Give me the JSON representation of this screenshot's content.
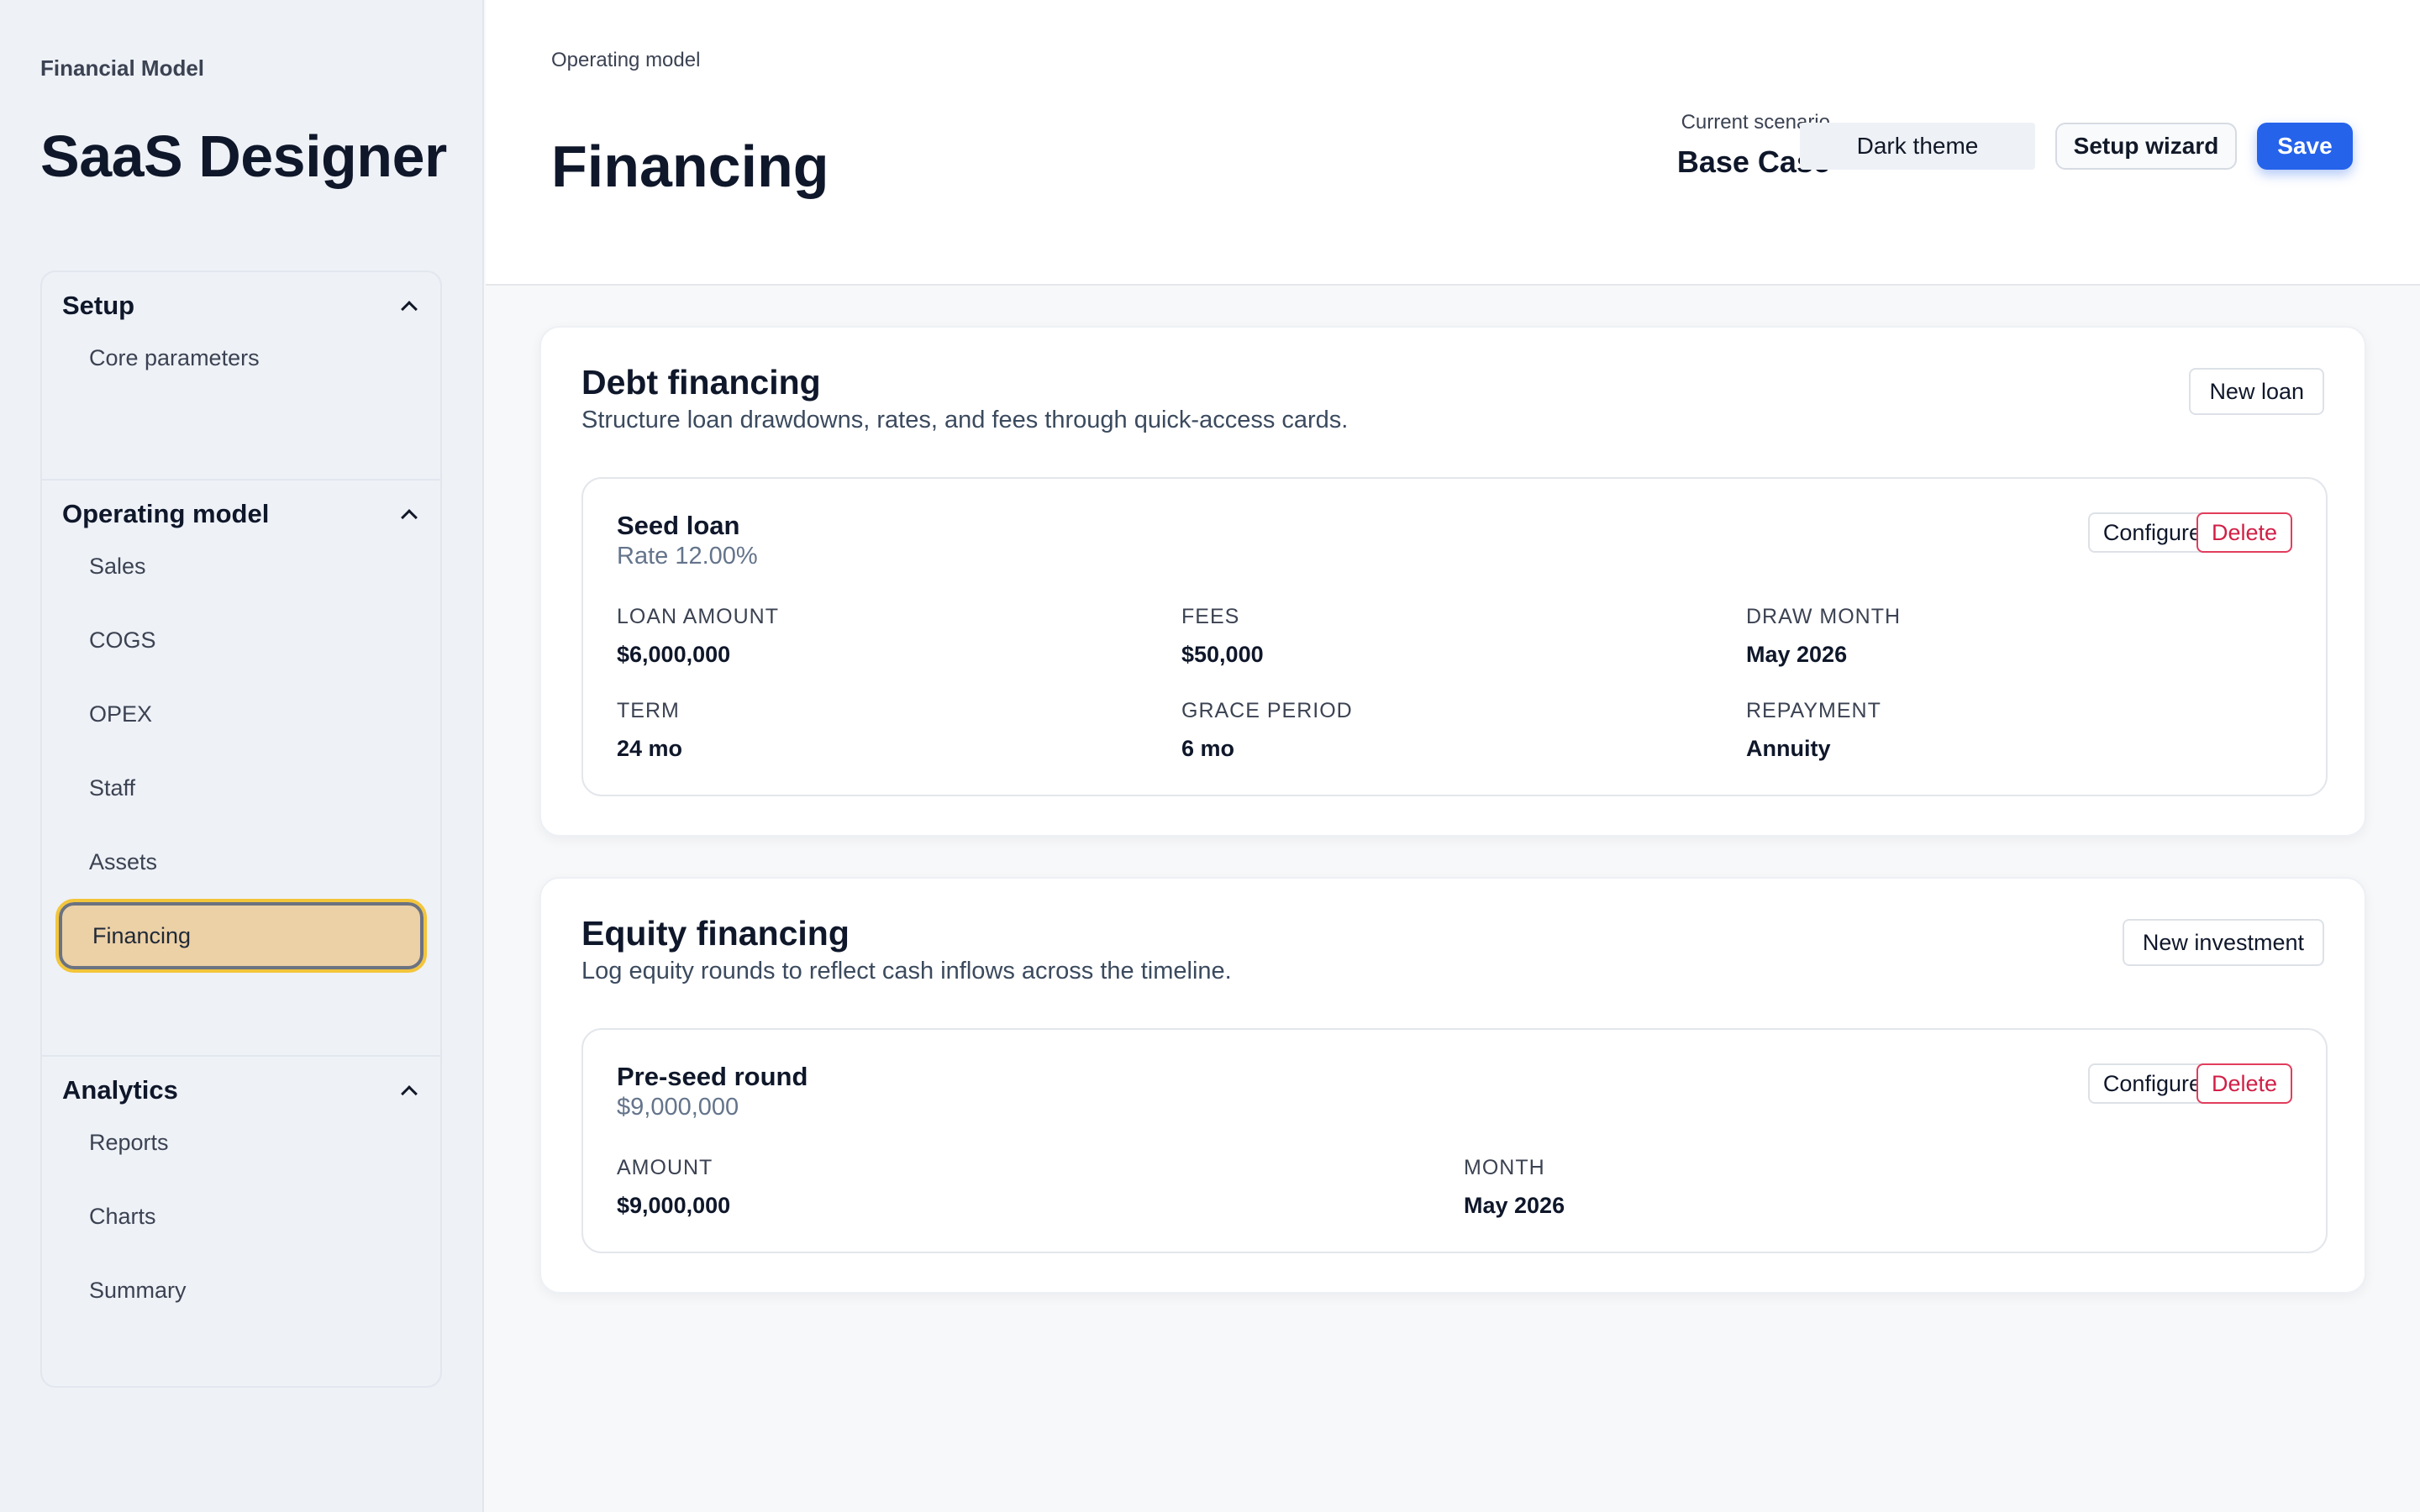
{
  "sidebar": {
    "kicker": "Financial Model",
    "title": "SaaS Designer",
    "sections": [
      {
        "label": "Setup",
        "items": [
          "Core parameters"
        ]
      },
      {
        "label": "Operating model",
        "items": [
          "Sales",
          "COGS",
          "OPEX",
          "Staff",
          "Assets",
          "Financing"
        ]
      },
      {
        "label": "Analytics",
        "items": [
          "Reports",
          "Charts",
          "Summary"
        ]
      }
    ],
    "active_item": "Financing",
    "active_highlight_color": "#ecd0a6"
  },
  "header": {
    "breadcrumb": "Operating model",
    "title": "Financing",
    "scenario_label": "Current scenario",
    "scenario_value": "Base Case",
    "theme_button": "Dark theme",
    "wizard_button": "Setup wizard",
    "save_button": "Save"
  },
  "debt": {
    "title": "Debt financing",
    "subtitle": "Structure loan drawdowns, rates, and fees through quick-access cards.",
    "new_button": "New loan",
    "loan": {
      "name": "Seed loan",
      "rate": "Rate 12.00%",
      "configure": "Configure",
      "delete": "Delete",
      "fields": [
        {
          "label": "LOAN AMOUNT",
          "value": "$6,000,000"
        },
        {
          "label": "FEES",
          "value": "$50,000"
        },
        {
          "label": "DRAW MONTH",
          "value": "May 2026"
        },
        {
          "label": "TERM",
          "value": "24 mo"
        },
        {
          "label": "GRACE PERIOD",
          "value": "6 mo"
        },
        {
          "label": "REPAYMENT",
          "value": "Annuity"
        }
      ]
    }
  },
  "equity": {
    "title": "Equity financing",
    "subtitle": "Log equity rounds to reflect cash inflows across the timeline.",
    "new_button": "New investment",
    "round": {
      "name": "Pre-seed round",
      "amount_meta": "$9,000,000",
      "configure": "Configure",
      "delete": "Delete",
      "fields": [
        {
          "label": "AMOUNT",
          "value": "$9,000,000"
        },
        {
          "label": "MONTH",
          "value": "May 2026"
        }
      ]
    }
  },
  "colors": {
    "primary": "#2563eb",
    "danger": "#d11f46",
    "sidebar_bg": "#eef1f6"
  }
}
